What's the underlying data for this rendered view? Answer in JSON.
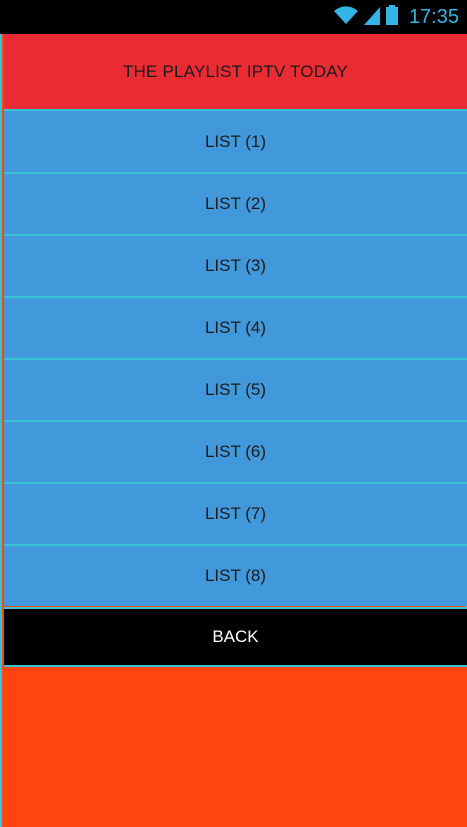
{
  "status_bar": {
    "time": "17:35",
    "icons": [
      "wifi-icon",
      "signal-icon",
      "battery-icon"
    ]
  },
  "header": {
    "title": "THE PLAYLIST IPTV TODAY"
  },
  "list": {
    "items": [
      {
        "label": "LIST (1)"
      },
      {
        "label": "LIST (2)"
      },
      {
        "label": "LIST (3)"
      },
      {
        "label": "LIST (4)"
      },
      {
        "label": "LIST (5)"
      },
      {
        "label": "LIST (6)"
      },
      {
        "label": "LIST (7)"
      },
      {
        "label": "LIST (8)"
      }
    ]
  },
  "back_button": {
    "label": "BACK"
  },
  "colors": {
    "header_bg": "#ea2b33",
    "list_bg": "#4199dc",
    "divider": "#36c3d3",
    "back_bg": "#000000",
    "page_bg": "#ff4411",
    "status_accent": "#33b5e5"
  }
}
